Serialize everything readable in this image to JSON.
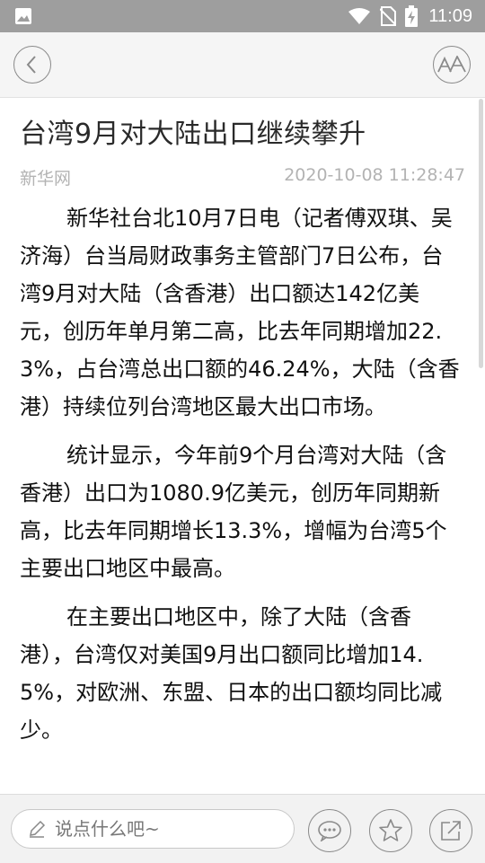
{
  "status_bar": {
    "time": "11:09"
  },
  "article": {
    "title": "台湾9月对大陆出口继续攀升",
    "source": "新华网",
    "datetime": "2020-10-08 11:28:47",
    "paragraphs": [
      "新华社台北10月7日电（记者傅双琪、吴济海）台当局财政事务主管部门7日公布，台湾9月对大陆（含香港）出口额达142亿美元，创历年单月第二高，比去年同期增加22.3%，占台湾总出口额的46.24%，大陆（含香港）持续位列台湾地区最大出口市场。",
      "统计显示，今年前9个月台湾对大陆（含香港）出口为1080.9亿美元，创历年同期新高，比去年同期增长13.3%，增幅为台湾5个主要出口地区中最高。",
      "在主要出口地区中，除了大陆（含香港），台湾仅对美国9月出口额同比增加14.5%，对欧洲、东盟、日本的出口额均同比减少。"
    ]
  },
  "comment": {
    "placeholder": "说点什么吧~"
  },
  "icons": {
    "back": "chevron-left-icon",
    "font_size": "font-size-icon",
    "comment": "chat-bubble-icon",
    "favorite": "star-icon",
    "share": "share-icon"
  },
  "colors": {
    "status_bar": "#9e9e9e",
    "toolbar": "#f5f5f5",
    "meta_text": "#b3b3b3"
  }
}
